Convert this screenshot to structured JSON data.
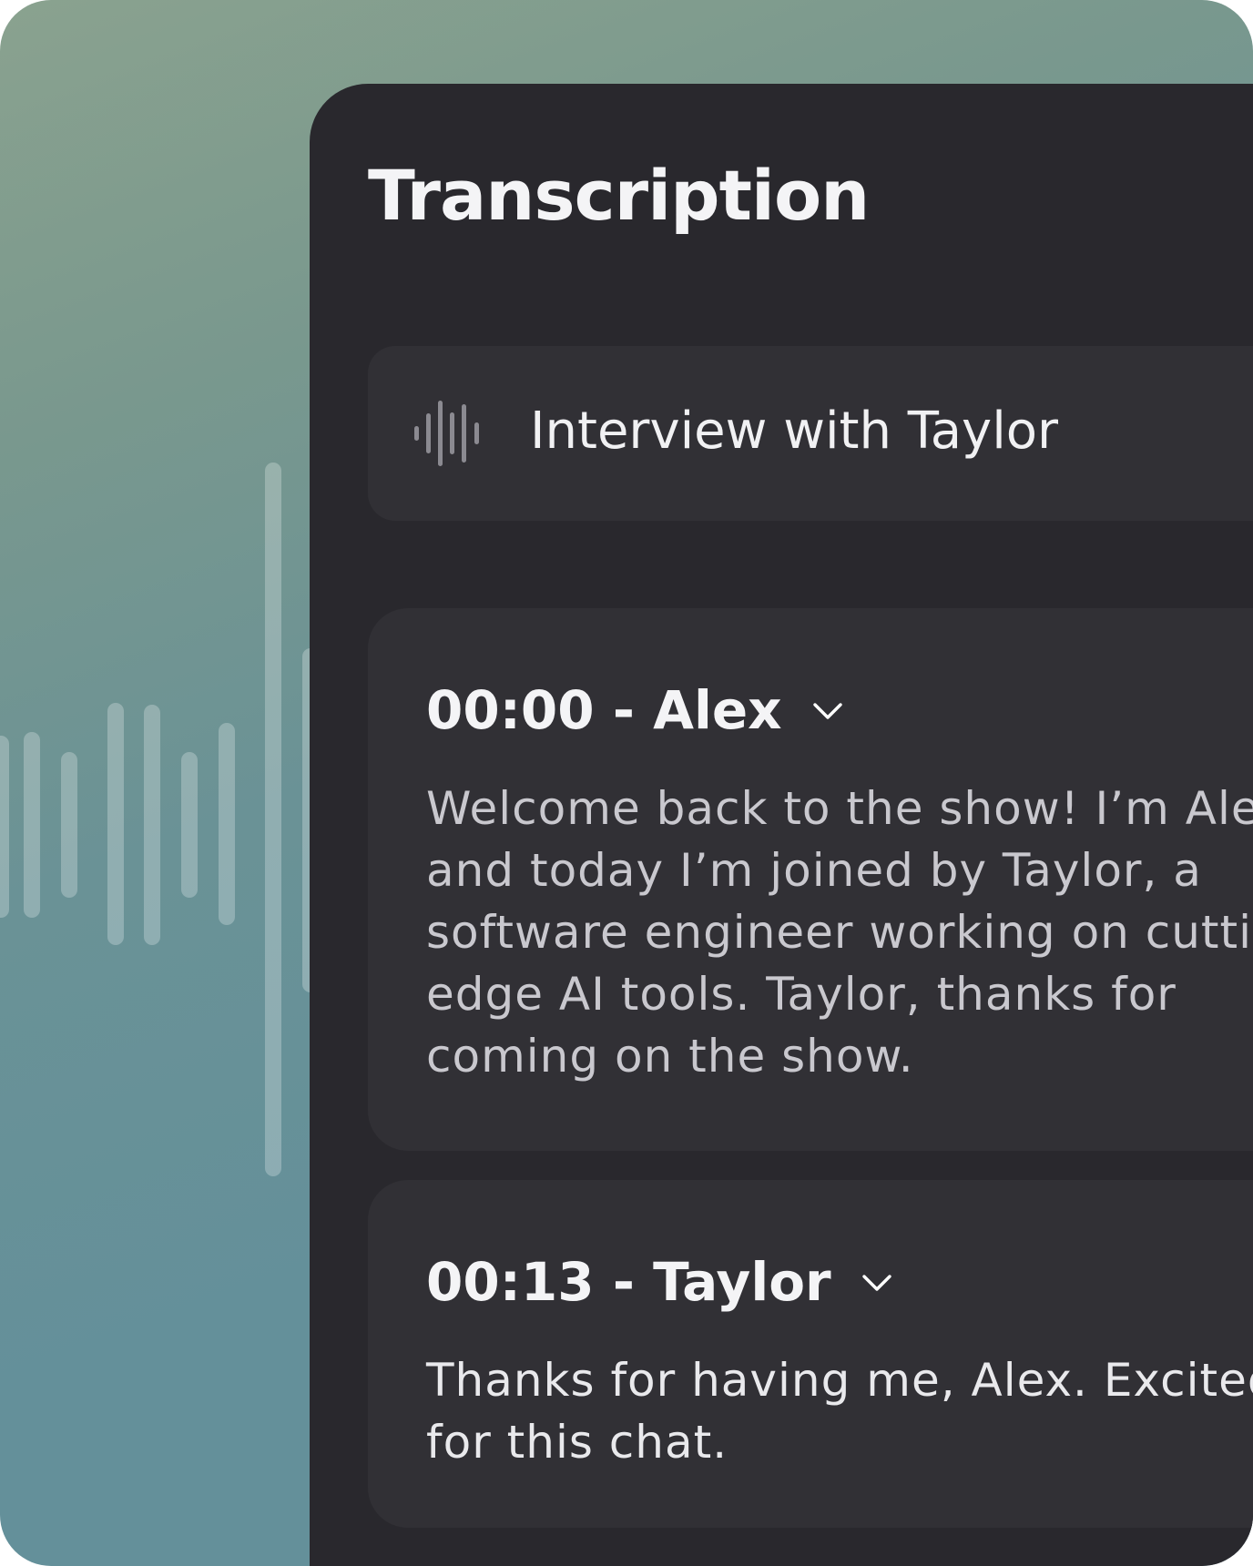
{
  "panel": {
    "title": "Transcription"
  },
  "recording": {
    "icon": "waveform-icon",
    "name": "Interview with Taylor"
  },
  "segments": [
    {
      "timestamp": "00:00",
      "speaker": "Alex",
      "heading": "00:00 - Alex",
      "text": "Welcome back to the show! I’m Alex, and today I’m joined by Taylor, a software engineer working on cutting-edge AI tools. Taylor, thanks for coming on the show.",
      "toggle_icon": "chevron-down-icon"
    },
    {
      "timestamp": "00:13",
      "speaker": "Taylor",
      "heading": "00:13 - Taylor",
      "text": "Thanks for having me, Alex. Excited for this chat.",
      "toggle_icon": "chevron-down-icon"
    }
  ],
  "colors": {
    "background_top": "#8aa28f",
    "background_bottom": "#63909a",
    "panel": "#29282d",
    "card": "#313035",
    "title_text": "#f4f4f6",
    "body_text": "#c9c8ce",
    "icon": "#8b8a91"
  }
}
